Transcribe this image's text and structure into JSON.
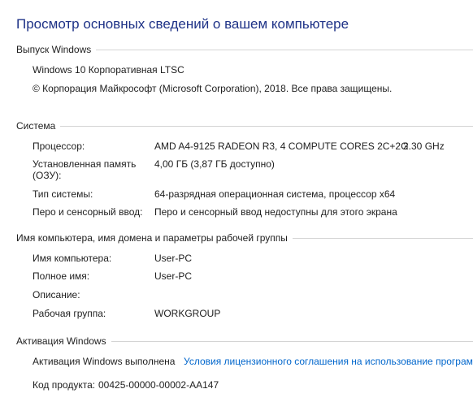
{
  "page": {
    "title": "Просмотр основных сведений о вашем компьютере"
  },
  "edition": {
    "section_label": "Выпуск Windows",
    "name": "Windows 10 Корпоративная LTSC",
    "copyright": "© Корпорация Майкрософт (Microsoft Corporation), 2018. Все права защищены."
  },
  "system": {
    "section_label": "Система",
    "processor_label": "Процессор:",
    "processor_value": "AMD A4-9125 RADEON R3, 4 COMPUTE CORES 2C+2G",
    "processor_freq": "2.30 GHz",
    "ram_label_line1": "Установленная память",
    "ram_label_line2": "(ОЗУ):",
    "ram_value": "4,00 ГБ (3,87 ГБ доступно)",
    "type_label": "Тип системы:",
    "type_value": "64-разрядная операционная система, процессор x64",
    "pen_label": "Перо и сенсорный ввод:",
    "pen_value": "Перо и сенсорный ввод недоступны для этого экрана"
  },
  "computer": {
    "section_label": "Имя компьютера, имя домена и параметры рабочей группы",
    "name_label": "Имя компьютера:",
    "name_value": "User-PC",
    "full_name_label": "Полное имя:",
    "full_name_value": "User-PC",
    "description_label": "Описание:",
    "description_value": "",
    "workgroup_label": "Рабочая группа:",
    "workgroup_value": "WORKGROUP"
  },
  "activation": {
    "section_label": "Активация Windows",
    "status": "Активация Windows выполнена",
    "license_link": "Условия лицензионного соглашения на использование програм",
    "product_id_label": "Код продукта:",
    "product_id_value": "00425-00000-00002-AA147"
  },
  "colors": {
    "title": "#1e3287",
    "link": "#0066cc",
    "rule": "#d4d4d4"
  }
}
